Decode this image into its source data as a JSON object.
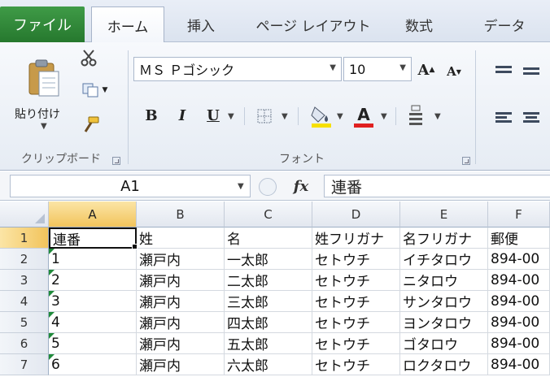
{
  "tabs": {
    "file": "ファイル",
    "items": [
      "ホーム",
      "挿入",
      "ページ レイアウト",
      "数式",
      "データ"
    ]
  },
  "clipboard": {
    "paste_label": "貼り付け",
    "group_label": "クリップボード"
  },
  "font": {
    "name_value": "ＭＳ Ｐゴシック",
    "size_value": "10",
    "group_label": "フォント",
    "bold": "B",
    "italic": "I",
    "underline": "U",
    "grow": "A",
    "shrink": "A",
    "color_letter": "A"
  },
  "formula_bar": {
    "name_box": "A1",
    "fx": "fx",
    "content": "連番"
  },
  "columns": [
    "A",
    "B",
    "C",
    "D",
    "E",
    "F"
  ],
  "rows": [
    {
      "num": "1",
      "cells": [
        "連番",
        "姓",
        "名",
        "姓フリガナ",
        "名フリガナ",
        "郵便"
      ]
    },
    {
      "num": "2",
      "cells": [
        "1",
        "瀬戸内",
        "一太郎",
        "セトウチ",
        "イチタロウ",
        "894-00"
      ]
    },
    {
      "num": "3",
      "cells": [
        "2",
        "瀬戸内",
        "二太郎",
        "セトウチ",
        "ニタロウ",
        "894-00"
      ]
    },
    {
      "num": "4",
      "cells": [
        "3",
        "瀬戸内",
        "三太郎",
        "セトウチ",
        "サンタロウ",
        "894-00"
      ]
    },
    {
      "num": "5",
      "cells": [
        "4",
        "瀬戸内",
        "四太郎",
        "セトウチ",
        "ヨンタロウ",
        "894-00"
      ]
    },
    {
      "num": "6",
      "cells": [
        "5",
        "瀬戸内",
        "五太郎",
        "セトウチ",
        "ゴタロウ",
        "894-00"
      ]
    },
    {
      "num": "7",
      "cells": [
        "6",
        "瀬戸内",
        "六太郎",
        "セトウチ",
        "ロクタロウ",
        "894-00"
      ]
    }
  ],
  "colors": {
    "file_tab": "#2e8534",
    "selection": "#f2c45c",
    "font_color_bar": "#e02020",
    "highlight_bar": "#f6e000",
    "error_marker": "#1f8a3a"
  },
  "icons": {
    "paste": "clipboard-icon",
    "cut": "scissors-icon",
    "copy": "copy-icon",
    "format_painter": "brush-icon",
    "borders": "border-icon",
    "fill": "paint-bucket-icon",
    "phonetic": "phonetic-icon",
    "align": "align-icon",
    "fx": "function-icon"
  }
}
